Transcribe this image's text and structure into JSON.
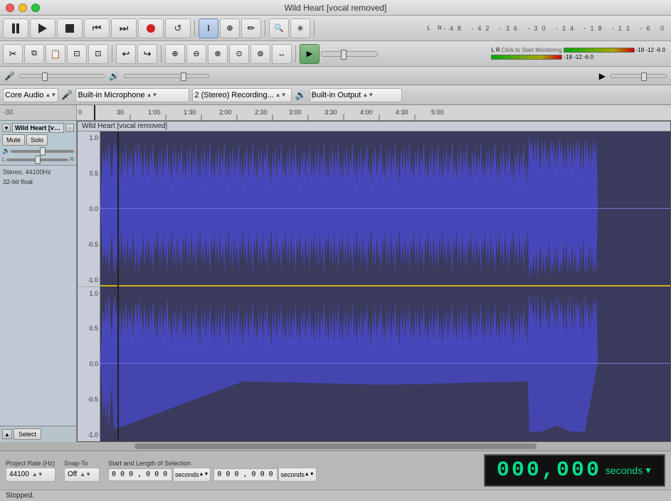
{
  "window": {
    "title": "Wild Heart [vocal removed]"
  },
  "titlebar": {
    "close": "×",
    "minimize": "−",
    "maximize": "+"
  },
  "transport": {
    "pause_label": "⏸",
    "play_label": "▶",
    "stop_label": "⏹",
    "skip_start_label": "⏮",
    "skip_end_label": "⏭",
    "record_label": "⏺",
    "loop_label": "↺"
  },
  "tools": {
    "select_label": "I",
    "multi_label": "⊕",
    "draw_label": "✏",
    "zoom_in_label": "🔍",
    "star_label": "✳",
    "envelope_label": "◆",
    "time_shift_label": "↔",
    "multi2_label": "⧈",
    "zoom_label": "⊕"
  },
  "edit_tools": {
    "cut_label": "✂",
    "copy_label": "⧉",
    "paste_label": "📋",
    "trim_label": "⊡",
    "silence_label": "⊡",
    "undo_label": "↩",
    "redo_label": "↪",
    "zoom_in": "⊕",
    "zoom_out": "⊖",
    "zoom_fit": "⊗",
    "zoom_sel": "⊙",
    "zoom_tog": "⊛",
    "scrub": "↔"
  },
  "mixer": {
    "mic_icon": "🎤",
    "volume_label": "",
    "play_icon": "▶",
    "speaker_icon": "🔊"
  },
  "devices": {
    "audio_host": "Core Audio",
    "mic_icon": "🎤",
    "input_device": "Built-in Microphone",
    "recording_mode": "2 (Stereo) Recording...",
    "speaker_icon": "🔊",
    "output_device": "Built-in Output"
  },
  "timeline": {
    "db_label": "-30",
    "marks": [
      "-30",
      "0",
      "30",
      "1:00",
      "1:30",
      "2:00",
      "2:30",
      "3:00",
      "3:30",
      "4:00",
      "4:30",
      "5:00"
    ]
  },
  "meters": {
    "l_label": "L",
    "r_label": "R",
    "lr_label": "LR",
    "scale_vals": [
      "-48",
      "-42",
      "-36",
      "-30",
      "-24",
      "-18",
      "-12",
      "-6",
      "0"
    ],
    "click_to_monitor": "Click to Start Monitoring",
    "top_scale": "-48  -42  -36  -30  -24  -18  -12  -6  0",
    "bot_scale": "-48  -42  -36  -30  -24  -18  -12  -6  0"
  },
  "track": {
    "name": "Wild Heart [voc...",
    "full_name": "Wild Heart [vocal removed]",
    "mute_label": "Mute",
    "solo_label": "Solo",
    "info": "Stereo, 44100Hz\n32-bit float",
    "select_label": "Select",
    "scale_vals": [
      "1.0",
      "0.5",
      "0.0",
      "-0.5",
      "-1.0",
      "1.0",
      "0.5",
      "0.0",
      "-0.5",
      "-1.0"
    ]
  },
  "bottom": {
    "project_rate_label": "Project Rate (Hz)",
    "project_rate_value": "44100",
    "snap_to_label": "Snap-To",
    "snap_to_value": "Off",
    "selection_label": "Start and Length of Selection",
    "pos1": "0 0 0 , 0 0 0",
    "pos1_unit": "seconds",
    "pos2": "0 0 0 , 0 0 0",
    "pos2_unit": "seconds",
    "time_display": "000,000 seconds",
    "status": "Stopped."
  }
}
